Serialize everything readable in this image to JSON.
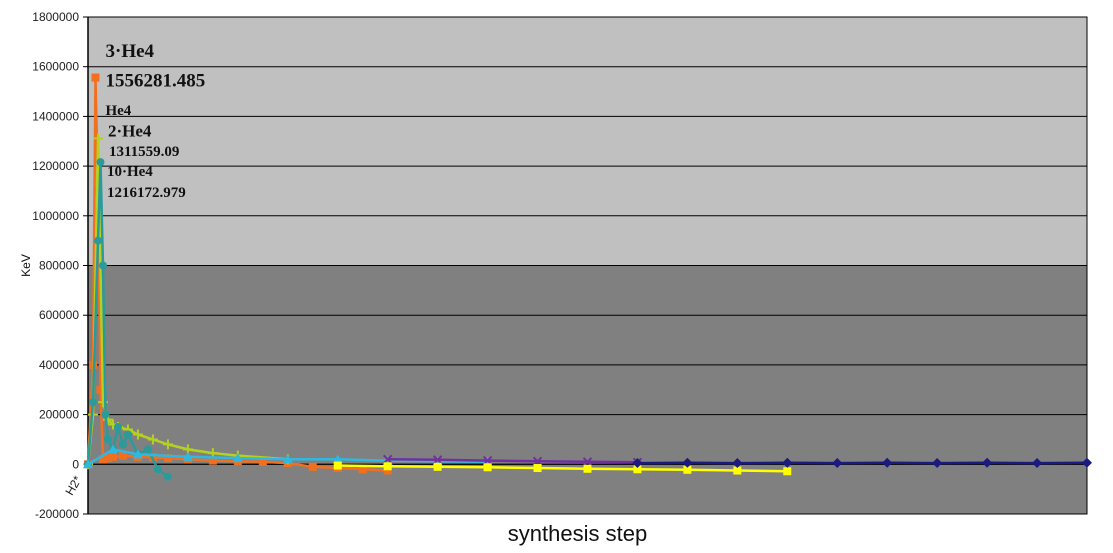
{
  "chart_data": {
    "type": "line",
    "title": "",
    "xlabel": "synthesis step",
    "ylabel": "KeV",
    "x_range": [
      0,
      200
    ],
    "ylim": [
      -200000,
      1800000
    ],
    "yticks": [
      -200000,
      0,
      200000,
      400000,
      600000,
      800000,
      1000000,
      1200000,
      1400000,
      1600000,
      1800000
    ],
    "ytick_labels": [
      "-200000",
      "0",
      "200000",
      "400000",
      "600000",
      "800000",
      "1000000",
      "1200000",
      "1400000",
      "1600000",
      "1800000"
    ],
    "grid": true,
    "legend": "none",
    "plot_background_upper": "#c0c0c0",
    "plot_background_lower": "#808080",
    "background_split_value": 800000,
    "x_axis_category_label": "H2*",
    "series": [
      {
        "color": "#f07020",
        "marker": "square",
        "x": [
          0,
          1,
          1.5,
          2,
          2.5,
          3,
          4,
          5,
          7,
          10,
          13,
          16,
          20,
          25,
          30,
          35,
          40,
          45,
          50,
          55,
          60
        ],
        "values": [
          0,
          400000,
          1556281.485,
          1100000,
          300000,
          20000,
          25000,
          30000,
          35000,
          30000,
          28000,
          25000,
          20000,
          15000,
          12000,
          10000,
          5000,
          -10000,
          -15000,
          -20000,
          -25000
        ]
      },
      {
        "color": "#b5d020",
        "marker": "plus",
        "x": [
          0,
          1,
          2,
          3,
          4,
          5,
          6,
          8,
          10,
          13,
          16,
          20,
          25,
          30,
          40
        ],
        "values": [
          0,
          200000,
          1311559.09,
          250000,
          180000,
          160000,
          150000,
          140000,
          120000,
          100000,
          80000,
          60000,
          45000,
          35000,
          20000
        ]
      },
      {
        "color": "#2a9a9a",
        "marker": "circle",
        "x": [
          0,
          1,
          2,
          2.5,
          3,
          3.5,
          4,
          5,
          6,
          7,
          8,
          10,
          12,
          14,
          16
        ],
        "values": [
          0,
          250000,
          900000,
          1216172.979,
          800000,
          200000,
          100000,
          60000,
          150000,
          80000,
          120000,
          40000,
          60000,
          -20000,
          -50000
        ]
      },
      {
        "color": "#30b8e0",
        "marker": "triangle",
        "x": [
          0,
          5,
          10,
          20,
          30,
          40,
          50,
          60,
          70,
          80
        ],
        "values": [
          0,
          60000,
          40000,
          30000,
          25000,
          20000,
          20000,
          15000,
          12000,
          10000
        ]
      },
      {
        "color": "#7030a0",
        "marker": "cross",
        "x": [
          60,
          70,
          80,
          90,
          100,
          110
        ],
        "values": [
          20000,
          18000,
          15000,
          12000,
          10000,
          8000
        ]
      },
      {
        "color": "#ffff00",
        "marker": "square",
        "x": [
          50,
          60,
          70,
          80,
          90,
          100,
          110,
          120,
          130,
          140
        ],
        "values": [
          -5000,
          -8000,
          -10000,
          -12000,
          -15000,
          -18000,
          -20000,
          -22000,
          -25000,
          -28000
        ]
      },
      {
        "color": "#1a1a80",
        "marker": "diamond",
        "x": [
          110,
          120,
          130,
          140,
          150,
          160,
          170,
          180,
          190,
          200
        ],
        "values": [
          5000,
          6000,
          5000,
          6000,
          5000,
          6000,
          5000,
          6000,
          5000,
          6000
        ]
      }
    ],
    "annotations": [
      {
        "text": "3·He4",
        "x": 2.3,
        "y": 1640000,
        "size": "large"
      },
      {
        "text": "1556281.485",
        "x": 2.3,
        "y": 1520000,
        "size": "large"
      },
      {
        "text": "He4",
        "x": 2.3,
        "y": 1405000,
        "size": "small"
      },
      {
        "text": "2·He4",
        "x": 2.8,
        "y": 1320000,
        "size": "medium"
      },
      {
        "text": "1311559.09",
        "x": 3.0,
        "y": 1240000,
        "size": "small"
      },
      {
        "text": "10·He4",
        "x": 2.6,
        "y": 1160000,
        "size": "small"
      },
      {
        "text": "1216172.979",
        "x": 2.6,
        "y": 1075000,
        "size": "small"
      }
    ]
  }
}
